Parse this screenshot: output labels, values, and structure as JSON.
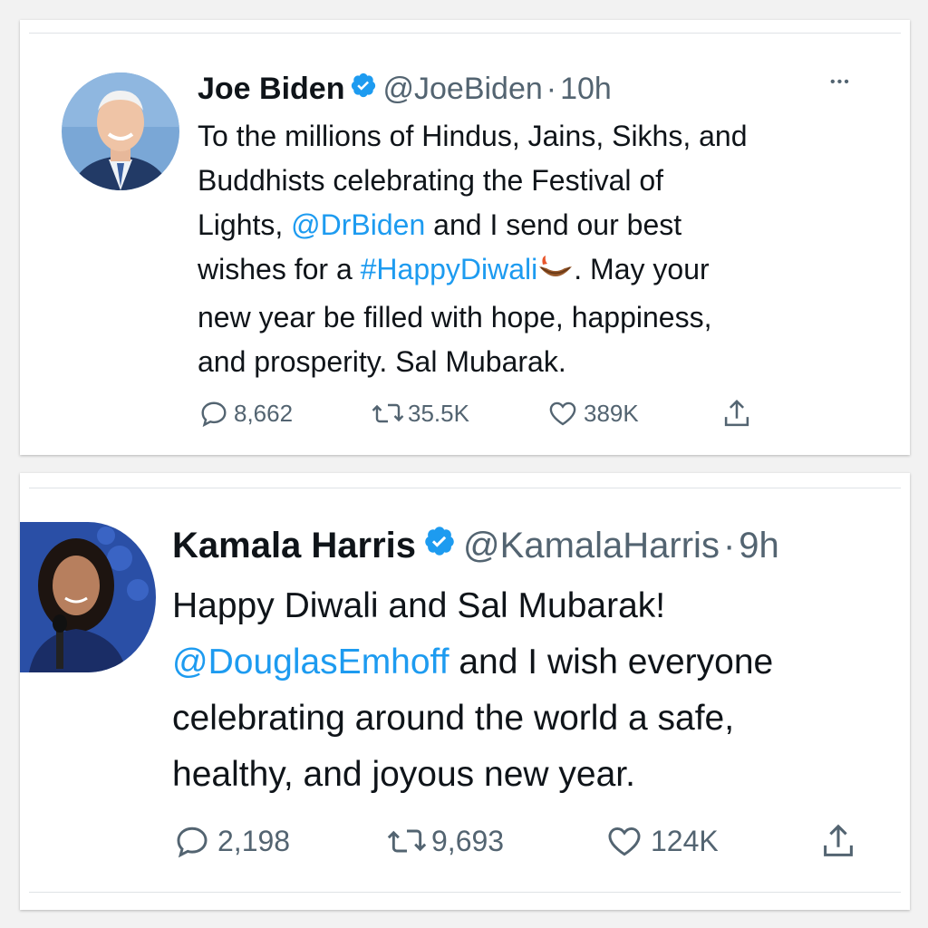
{
  "tweets": [
    {
      "name": "Joe Biden",
      "handle": "@JoeBiden",
      "dot": "·",
      "time": "10h",
      "more": "•••",
      "lines": [
        {
          "parts": [
            "To the millions of Hindus, Jains, Sikhs, and"
          ]
        },
        {
          "parts": [
            "Buddhists celebrating the Festival of"
          ]
        },
        {
          "pre": "Lights, ",
          "link": "@DrBiden",
          "post": " and I send our best"
        },
        {
          "pre": "wishes for a ",
          "link": "#HappyDiwali",
          "emoji": "🪔",
          "post": ". May your"
        },
        {
          "parts": [
            "new year be filled with hope, happiness,"
          ]
        },
        {
          "parts": [
            "and prosperity. Sal Mubarak."
          ]
        }
      ],
      "replies": "8,662",
      "retweets": "35.5K",
      "likes": "389K"
    },
    {
      "name": "Kamala Harris",
      "handle": "@KamalaHarris",
      "dot": "·",
      "time": "9h",
      "lines": [
        {
          "parts": [
            "Happy Diwali and Sal Mubarak!"
          ]
        },
        {
          "pre": "",
          "link": "@DouglasEmhoff",
          "post": " and I wish everyone"
        },
        {
          "parts": [
            "celebrating around the world a safe,"
          ]
        },
        {
          "parts": [
            "healthy, and joyous new year."
          ]
        }
      ],
      "replies": "2,198",
      "retweets": "9,693",
      "likes": "124K"
    }
  ],
  "colors": {
    "link": "#1d9bf0",
    "verified": "#1d9bf0",
    "muted": "#536471",
    "text": "#0f1419"
  },
  "icons": [
    "verified-badge-icon",
    "reply-icon",
    "retweet-icon",
    "like-icon",
    "share-icon",
    "more-icon"
  ]
}
